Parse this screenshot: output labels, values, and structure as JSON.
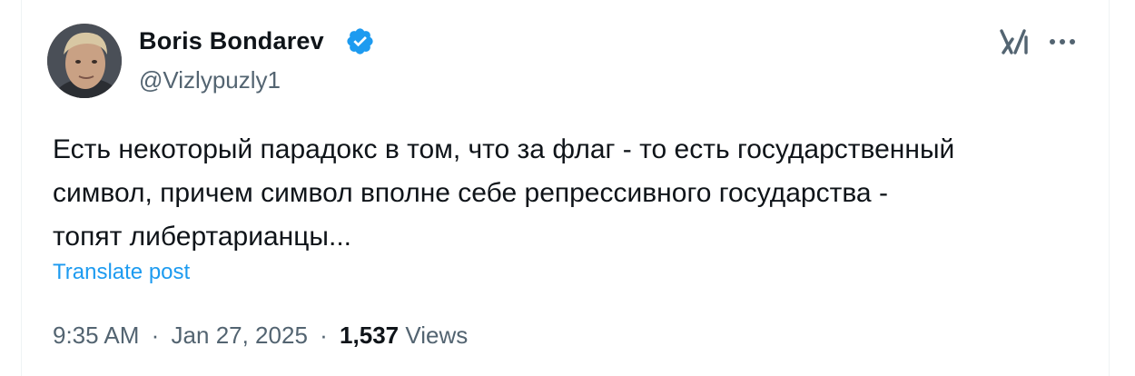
{
  "author": {
    "display_name": "Boris Bondarev",
    "handle": "@Vizlypuzly1",
    "verified_color": "#1d9bf0"
  },
  "header": {
    "grok_icon": "grok-icon",
    "more_icon": "more-options-icon"
  },
  "tweet": {
    "lines": [
      "Есть некоторый парадокс в том, что за флаг - то есть государственный",
      "символ, причем символ вполне себе репрессивного государства -",
      "топят либертарианцы..."
    ],
    "translate_label": "Translate post"
  },
  "meta": {
    "time": "9:35 AM",
    "separator": "·",
    "date": "Jan 27, 2025",
    "views_count": "1,537",
    "views_label": "Views"
  },
  "colors": {
    "accent": "#1d9bf0",
    "text": "#0f1419",
    "secondary": "#536471"
  }
}
